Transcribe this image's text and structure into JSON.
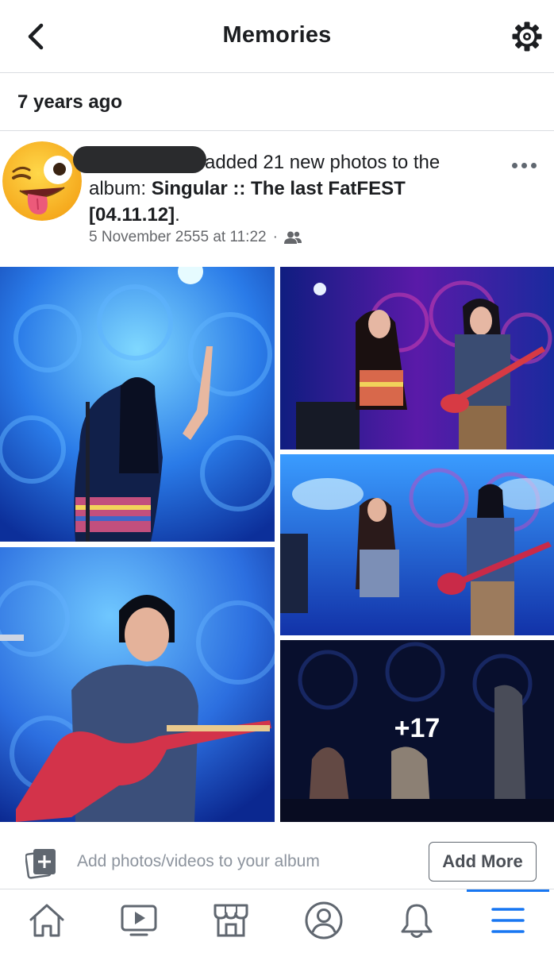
{
  "header": {
    "title": "Memories",
    "back_icon": "chevron-left-icon",
    "settings_icon": "gear-icon"
  },
  "section": {
    "label": "7 years ago"
  },
  "post": {
    "action_text": "added 21 new photos to the album:",
    "album_name": "Singular :: The last FatFEST [04.11.12]",
    "album_suffix": ".",
    "timestamp": "5 November 2555 at 11:22",
    "separator": "·",
    "audience_icon": "friends-icon",
    "more_icon": "more-horizontal-icon",
    "avatar_icon": "winking-tongue-emoji"
  },
  "photos": {
    "overlay_count": "+17"
  },
  "add_bar": {
    "placeholder": "Add photos/videos to your album",
    "button_label": "Add More"
  },
  "tabbar": {
    "items": [
      {
        "name": "home",
        "icon": "home-icon"
      },
      {
        "name": "watch",
        "icon": "video-icon"
      },
      {
        "name": "marketplace",
        "icon": "shop-icon"
      },
      {
        "name": "profile",
        "icon": "profile-icon"
      },
      {
        "name": "notifications",
        "icon": "bell-icon"
      },
      {
        "name": "menu",
        "icon": "menu-icon",
        "active": true
      }
    ]
  },
  "colors": {
    "accent": "#1877f2",
    "text_primary": "#1c1e21",
    "text_secondary": "#65676b",
    "divider": "#dadde1",
    "stage_blue": "#1f5fd6"
  }
}
